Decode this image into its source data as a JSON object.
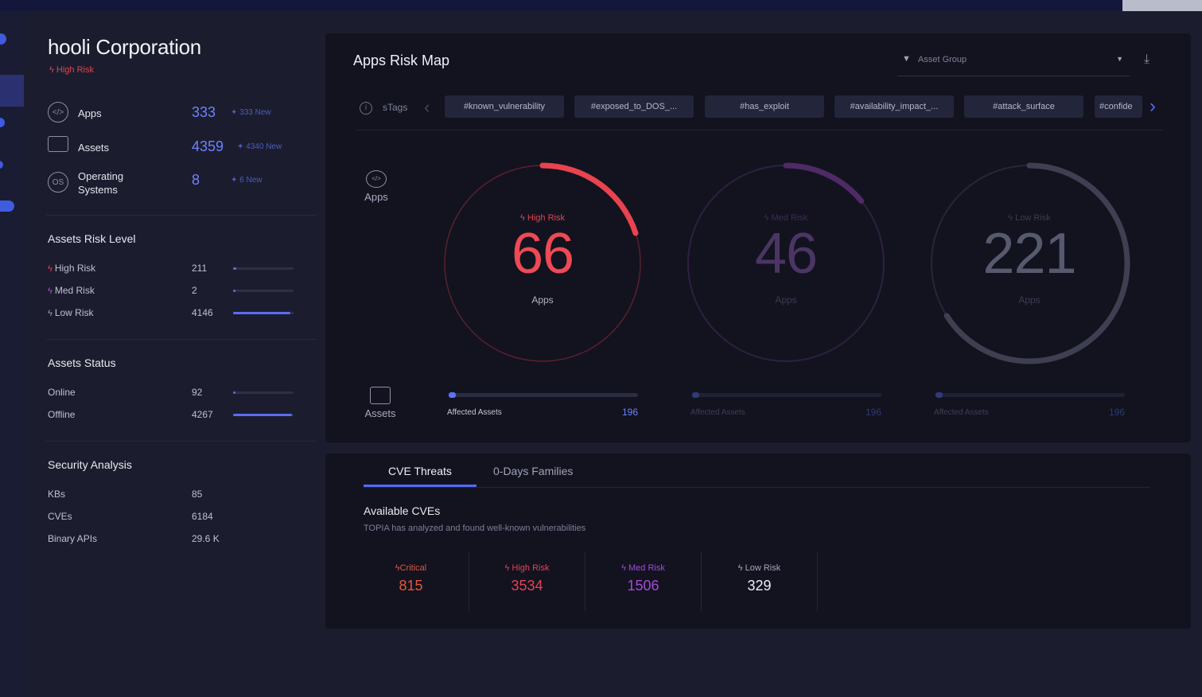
{
  "company": {
    "name": "hooli Corporation",
    "risk": "High Risk"
  },
  "overview": [
    {
      "label": "Apps",
      "value": "333",
      "new": "333 New",
      "icon": "apps-icon"
    },
    {
      "label": "Assets",
      "value": "4359",
      "new": "4340 New",
      "icon": "monitor-icon"
    },
    {
      "label": "Operating Systems",
      "value": "8",
      "new": "6 New",
      "icon": "os-icon"
    }
  ],
  "assets_risk": {
    "title": "Assets Risk Level",
    "rows": [
      {
        "label": "High Risk",
        "value": "211",
        "fill": 0.05,
        "color": "#e04356"
      },
      {
        "label": "Med Risk",
        "value": "2",
        "fill": 0.0,
        "color": "#b04dd6"
      },
      {
        "label": "Low Risk",
        "value": "4146",
        "fill": 0.95,
        "color": "#9ea1b5"
      }
    ]
  },
  "assets_status": {
    "title": "Assets Status",
    "rows": [
      {
        "label": "Online",
        "value": "92",
        "fill": 0.02
      },
      {
        "label": "Offline",
        "value": "4267",
        "fill": 0.98
      }
    ]
  },
  "security": {
    "title": "Security Analysis",
    "rows": [
      {
        "label": "KBs",
        "value": "85"
      },
      {
        "label": "CVEs",
        "value": "6184"
      },
      {
        "label": "Binary APIs",
        "value": "29.6 K"
      }
    ]
  },
  "risk_map": {
    "title": "Apps Risk Map",
    "asset_group": "Asset Group",
    "tags_label": "sTags",
    "tags": [
      "#known_vulnerability",
      "#exposed_to_DOS_...",
      "#has_exploit",
      "#availability_impact_...",
      "#attack_surface",
      "#confide"
    ],
    "apps_label": "Apps",
    "assets_label": "Assets",
    "gauges": [
      {
        "risk": "High Risk",
        "value": "66",
        "unit": "Apps",
        "fraction": 0.2,
        "color": "#e8434f",
        "ring": "#5c1f2f",
        "affected_label": "Affected Assets",
        "affected": "196",
        "active": true
      },
      {
        "risk": "Med Risk",
        "value": "46",
        "unit": "Apps",
        "fraction": 0.14,
        "color": "#4e2a66",
        "ring": "#2e2040",
        "affected_label": "Affected Assets",
        "affected": "196",
        "active": false
      },
      {
        "risk": "Low Risk",
        "value": "221",
        "unit": "Apps",
        "fraction": 0.66,
        "color": "#3e4052",
        "ring": "#25273a",
        "affected_label": "Affected Assets",
        "affected": "196",
        "active": false
      }
    ]
  },
  "cve": {
    "tabs": [
      "CVE Threats",
      "0-Days Families"
    ],
    "title": "Available CVEs",
    "subtitle": "TOPIA has analyzed and found well-known vulnerabilities",
    "levels": [
      {
        "label": "Critical",
        "value": "815",
        "color": "#e0573f"
      },
      {
        "label": "High Risk",
        "value": "3534",
        "color": "#e04356"
      },
      {
        "label": "Med Risk",
        "value": "1506",
        "color": "#a24bd8"
      },
      {
        "label": "Low Risk",
        "value": "329",
        "color": "#e8e9f1"
      }
    ]
  }
}
